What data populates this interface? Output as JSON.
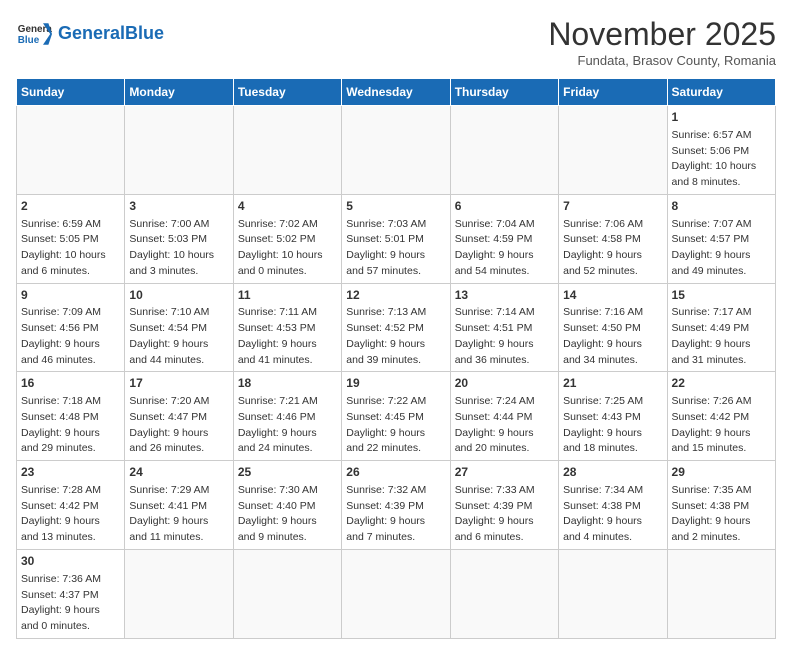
{
  "header": {
    "logo_general": "General",
    "logo_blue": "Blue",
    "month": "November 2025",
    "location": "Fundata, Brasov County, Romania"
  },
  "weekdays": [
    "Sunday",
    "Monday",
    "Tuesday",
    "Wednesday",
    "Thursday",
    "Friday",
    "Saturday"
  ],
  "weeks": [
    [
      {
        "day": "",
        "info": ""
      },
      {
        "day": "",
        "info": ""
      },
      {
        "day": "",
        "info": ""
      },
      {
        "day": "",
        "info": ""
      },
      {
        "day": "",
        "info": ""
      },
      {
        "day": "",
        "info": ""
      },
      {
        "day": "1",
        "info": "Sunrise: 6:57 AM\nSunset: 5:06 PM\nDaylight: 10 hours\nand 8 minutes."
      }
    ],
    [
      {
        "day": "2",
        "info": "Sunrise: 6:59 AM\nSunset: 5:05 PM\nDaylight: 10 hours\nand 6 minutes."
      },
      {
        "day": "3",
        "info": "Sunrise: 7:00 AM\nSunset: 5:03 PM\nDaylight: 10 hours\nand 3 minutes."
      },
      {
        "day": "4",
        "info": "Sunrise: 7:02 AM\nSunset: 5:02 PM\nDaylight: 10 hours\nand 0 minutes."
      },
      {
        "day": "5",
        "info": "Sunrise: 7:03 AM\nSunset: 5:01 PM\nDaylight: 9 hours\nand 57 minutes."
      },
      {
        "day": "6",
        "info": "Sunrise: 7:04 AM\nSunset: 4:59 PM\nDaylight: 9 hours\nand 54 minutes."
      },
      {
        "day": "7",
        "info": "Sunrise: 7:06 AM\nSunset: 4:58 PM\nDaylight: 9 hours\nand 52 minutes."
      },
      {
        "day": "8",
        "info": "Sunrise: 7:07 AM\nSunset: 4:57 PM\nDaylight: 9 hours\nand 49 minutes."
      }
    ],
    [
      {
        "day": "9",
        "info": "Sunrise: 7:09 AM\nSunset: 4:56 PM\nDaylight: 9 hours\nand 46 minutes."
      },
      {
        "day": "10",
        "info": "Sunrise: 7:10 AM\nSunset: 4:54 PM\nDaylight: 9 hours\nand 44 minutes."
      },
      {
        "day": "11",
        "info": "Sunrise: 7:11 AM\nSunset: 4:53 PM\nDaylight: 9 hours\nand 41 minutes."
      },
      {
        "day": "12",
        "info": "Sunrise: 7:13 AM\nSunset: 4:52 PM\nDaylight: 9 hours\nand 39 minutes."
      },
      {
        "day": "13",
        "info": "Sunrise: 7:14 AM\nSunset: 4:51 PM\nDaylight: 9 hours\nand 36 minutes."
      },
      {
        "day": "14",
        "info": "Sunrise: 7:16 AM\nSunset: 4:50 PM\nDaylight: 9 hours\nand 34 minutes."
      },
      {
        "day": "15",
        "info": "Sunrise: 7:17 AM\nSunset: 4:49 PM\nDaylight: 9 hours\nand 31 minutes."
      }
    ],
    [
      {
        "day": "16",
        "info": "Sunrise: 7:18 AM\nSunset: 4:48 PM\nDaylight: 9 hours\nand 29 minutes."
      },
      {
        "day": "17",
        "info": "Sunrise: 7:20 AM\nSunset: 4:47 PM\nDaylight: 9 hours\nand 26 minutes."
      },
      {
        "day": "18",
        "info": "Sunrise: 7:21 AM\nSunset: 4:46 PM\nDaylight: 9 hours\nand 24 minutes."
      },
      {
        "day": "19",
        "info": "Sunrise: 7:22 AM\nSunset: 4:45 PM\nDaylight: 9 hours\nand 22 minutes."
      },
      {
        "day": "20",
        "info": "Sunrise: 7:24 AM\nSunset: 4:44 PM\nDaylight: 9 hours\nand 20 minutes."
      },
      {
        "day": "21",
        "info": "Sunrise: 7:25 AM\nSunset: 4:43 PM\nDaylight: 9 hours\nand 18 minutes."
      },
      {
        "day": "22",
        "info": "Sunrise: 7:26 AM\nSunset: 4:42 PM\nDaylight: 9 hours\nand 15 minutes."
      }
    ],
    [
      {
        "day": "23",
        "info": "Sunrise: 7:28 AM\nSunset: 4:42 PM\nDaylight: 9 hours\nand 13 minutes."
      },
      {
        "day": "24",
        "info": "Sunrise: 7:29 AM\nSunset: 4:41 PM\nDaylight: 9 hours\nand 11 minutes."
      },
      {
        "day": "25",
        "info": "Sunrise: 7:30 AM\nSunset: 4:40 PM\nDaylight: 9 hours\nand 9 minutes."
      },
      {
        "day": "26",
        "info": "Sunrise: 7:32 AM\nSunset: 4:39 PM\nDaylight: 9 hours\nand 7 minutes."
      },
      {
        "day": "27",
        "info": "Sunrise: 7:33 AM\nSunset: 4:39 PM\nDaylight: 9 hours\nand 6 minutes."
      },
      {
        "day": "28",
        "info": "Sunrise: 7:34 AM\nSunset: 4:38 PM\nDaylight: 9 hours\nand 4 minutes."
      },
      {
        "day": "29",
        "info": "Sunrise: 7:35 AM\nSunset: 4:38 PM\nDaylight: 9 hours\nand 2 minutes."
      }
    ],
    [
      {
        "day": "30",
        "info": "Sunrise: 7:36 AM\nSunset: 4:37 PM\nDaylight: 9 hours\nand 0 minutes."
      },
      {
        "day": "",
        "info": ""
      },
      {
        "day": "",
        "info": ""
      },
      {
        "day": "",
        "info": ""
      },
      {
        "day": "",
        "info": ""
      },
      {
        "day": "",
        "info": ""
      },
      {
        "day": "",
        "info": ""
      }
    ]
  ]
}
